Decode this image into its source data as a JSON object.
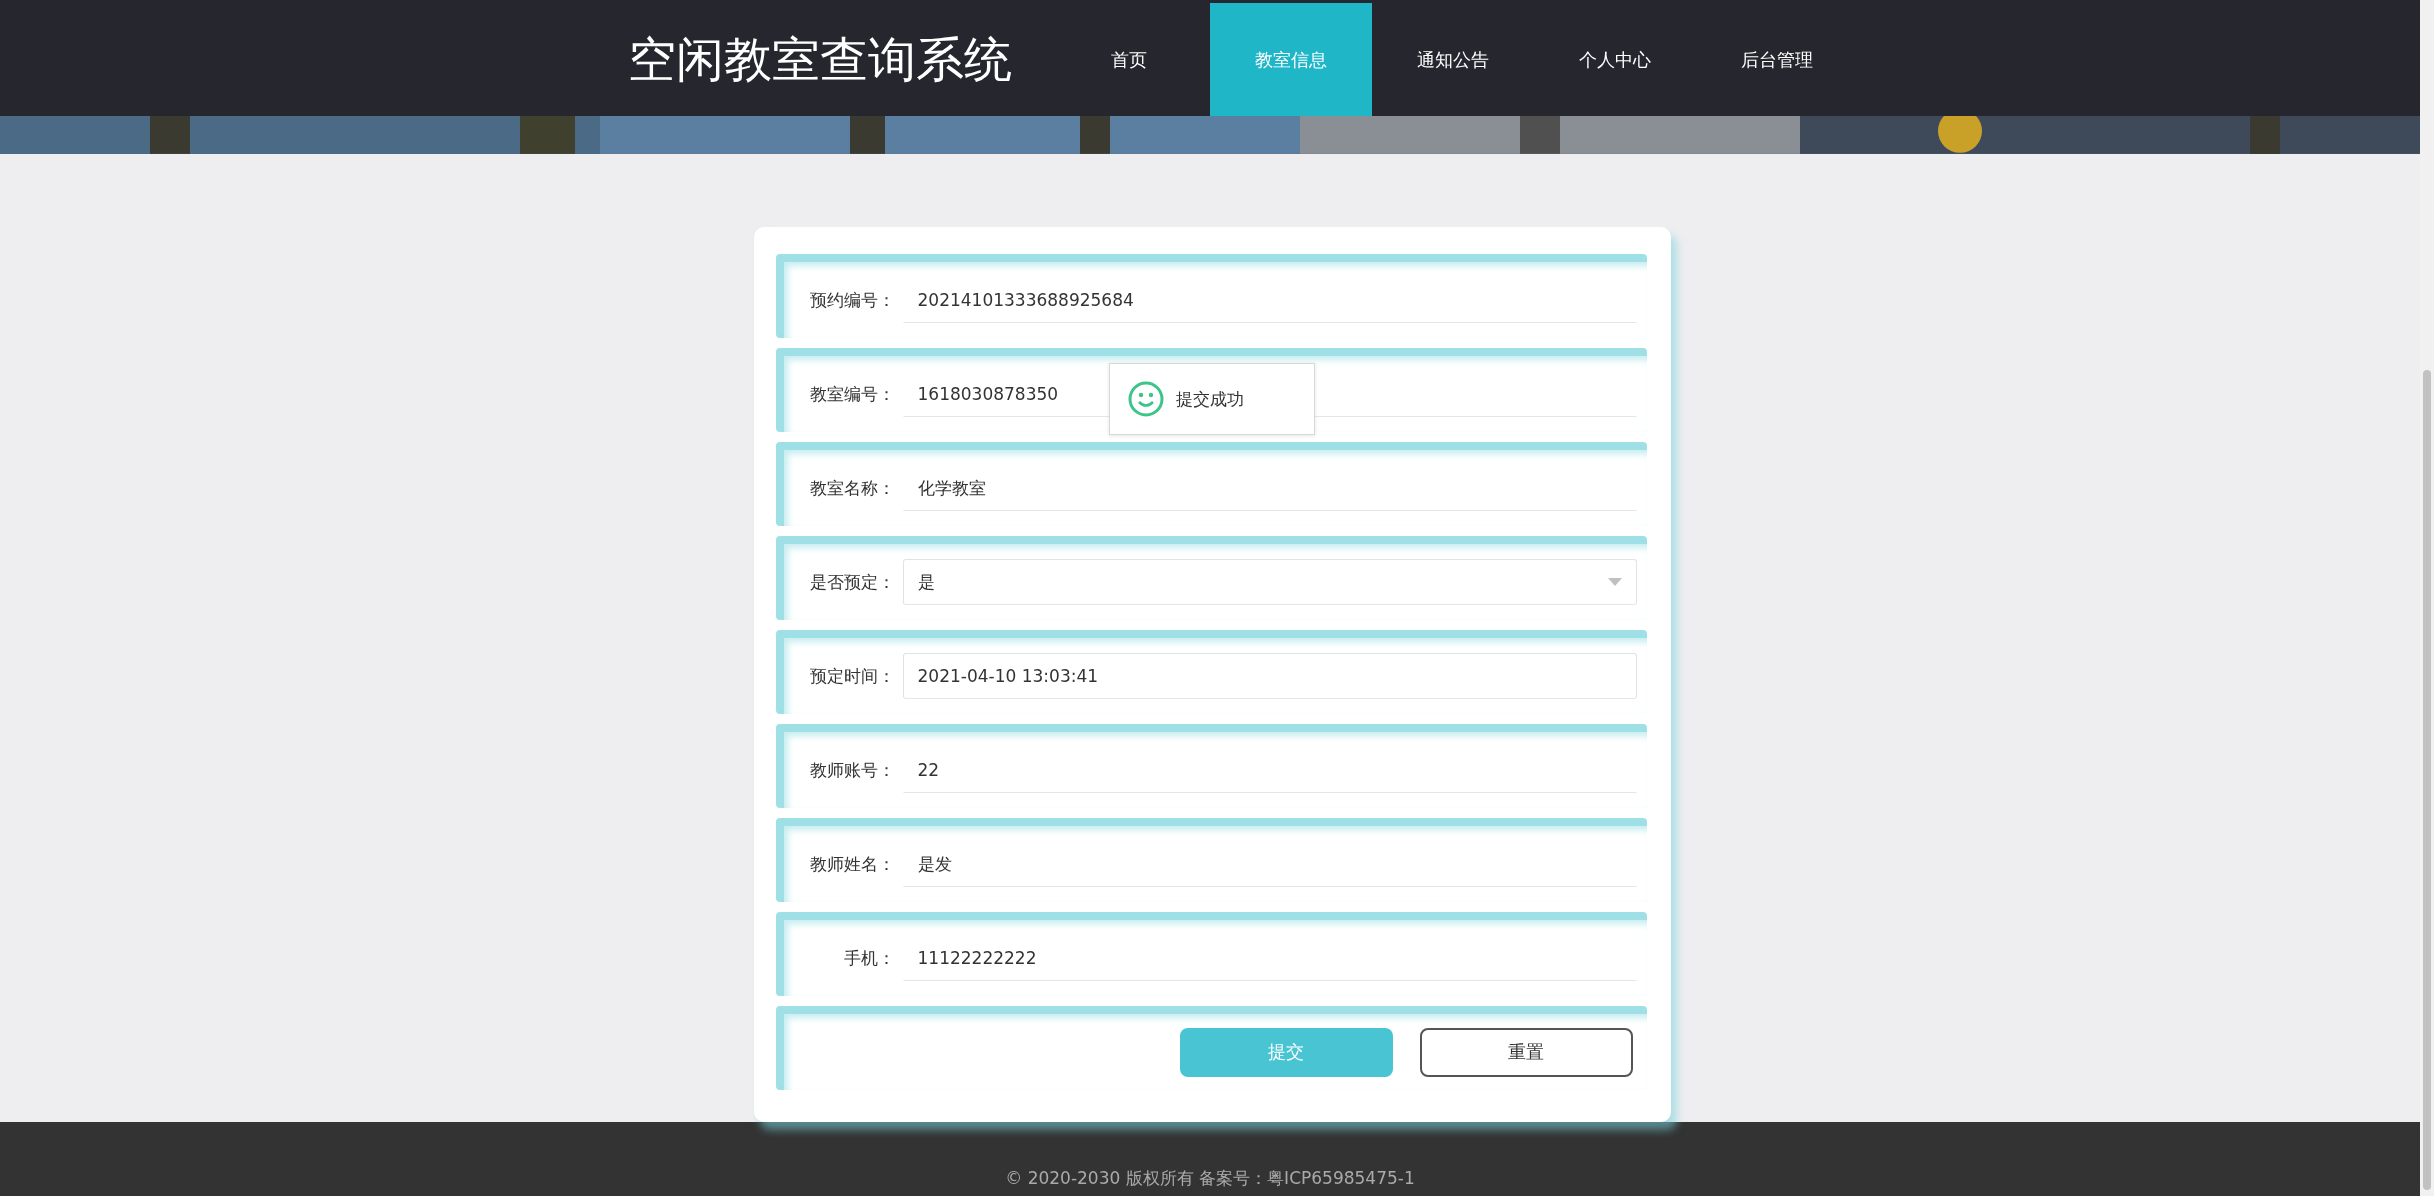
{
  "header": {
    "title": "空闲教室查询系统",
    "nav": [
      {
        "label": "首页",
        "selected": false
      },
      {
        "label": "教室信息",
        "selected": true
      },
      {
        "label": "通知公告",
        "selected": false
      },
      {
        "label": "个人中心",
        "selected": false
      },
      {
        "label": "后台管理",
        "selected": false
      }
    ]
  },
  "form": {
    "fields": [
      {
        "label": "预约编号：",
        "value": "20214101333688925684",
        "kind": "text"
      },
      {
        "label": "教室编号：",
        "value": "1618030878350",
        "kind": "text"
      },
      {
        "label": "教室名称：",
        "value": "化学教室",
        "kind": "text"
      },
      {
        "label": "是否预定：",
        "value": "是",
        "kind": "select"
      },
      {
        "label": "预定时间：",
        "value": "2021-04-10 13:03:41",
        "kind": "datetime"
      },
      {
        "label": "教师账号：",
        "value": "22",
        "kind": "text"
      },
      {
        "label": "教师姓名：",
        "value": "是发",
        "kind": "text"
      },
      {
        "label": "手机：",
        "value": "11122222222",
        "kind": "text"
      }
    ],
    "buttons": [
      {
        "label": "提交",
        "kind": "primary"
      },
      {
        "label": "重置",
        "kind": "secondary"
      }
    ]
  },
  "toast": {
    "message": "提交成功"
  },
  "footer": {
    "text": "© 2020-2030 版权所有 备案号：粤ICP65985475-1"
  }
}
